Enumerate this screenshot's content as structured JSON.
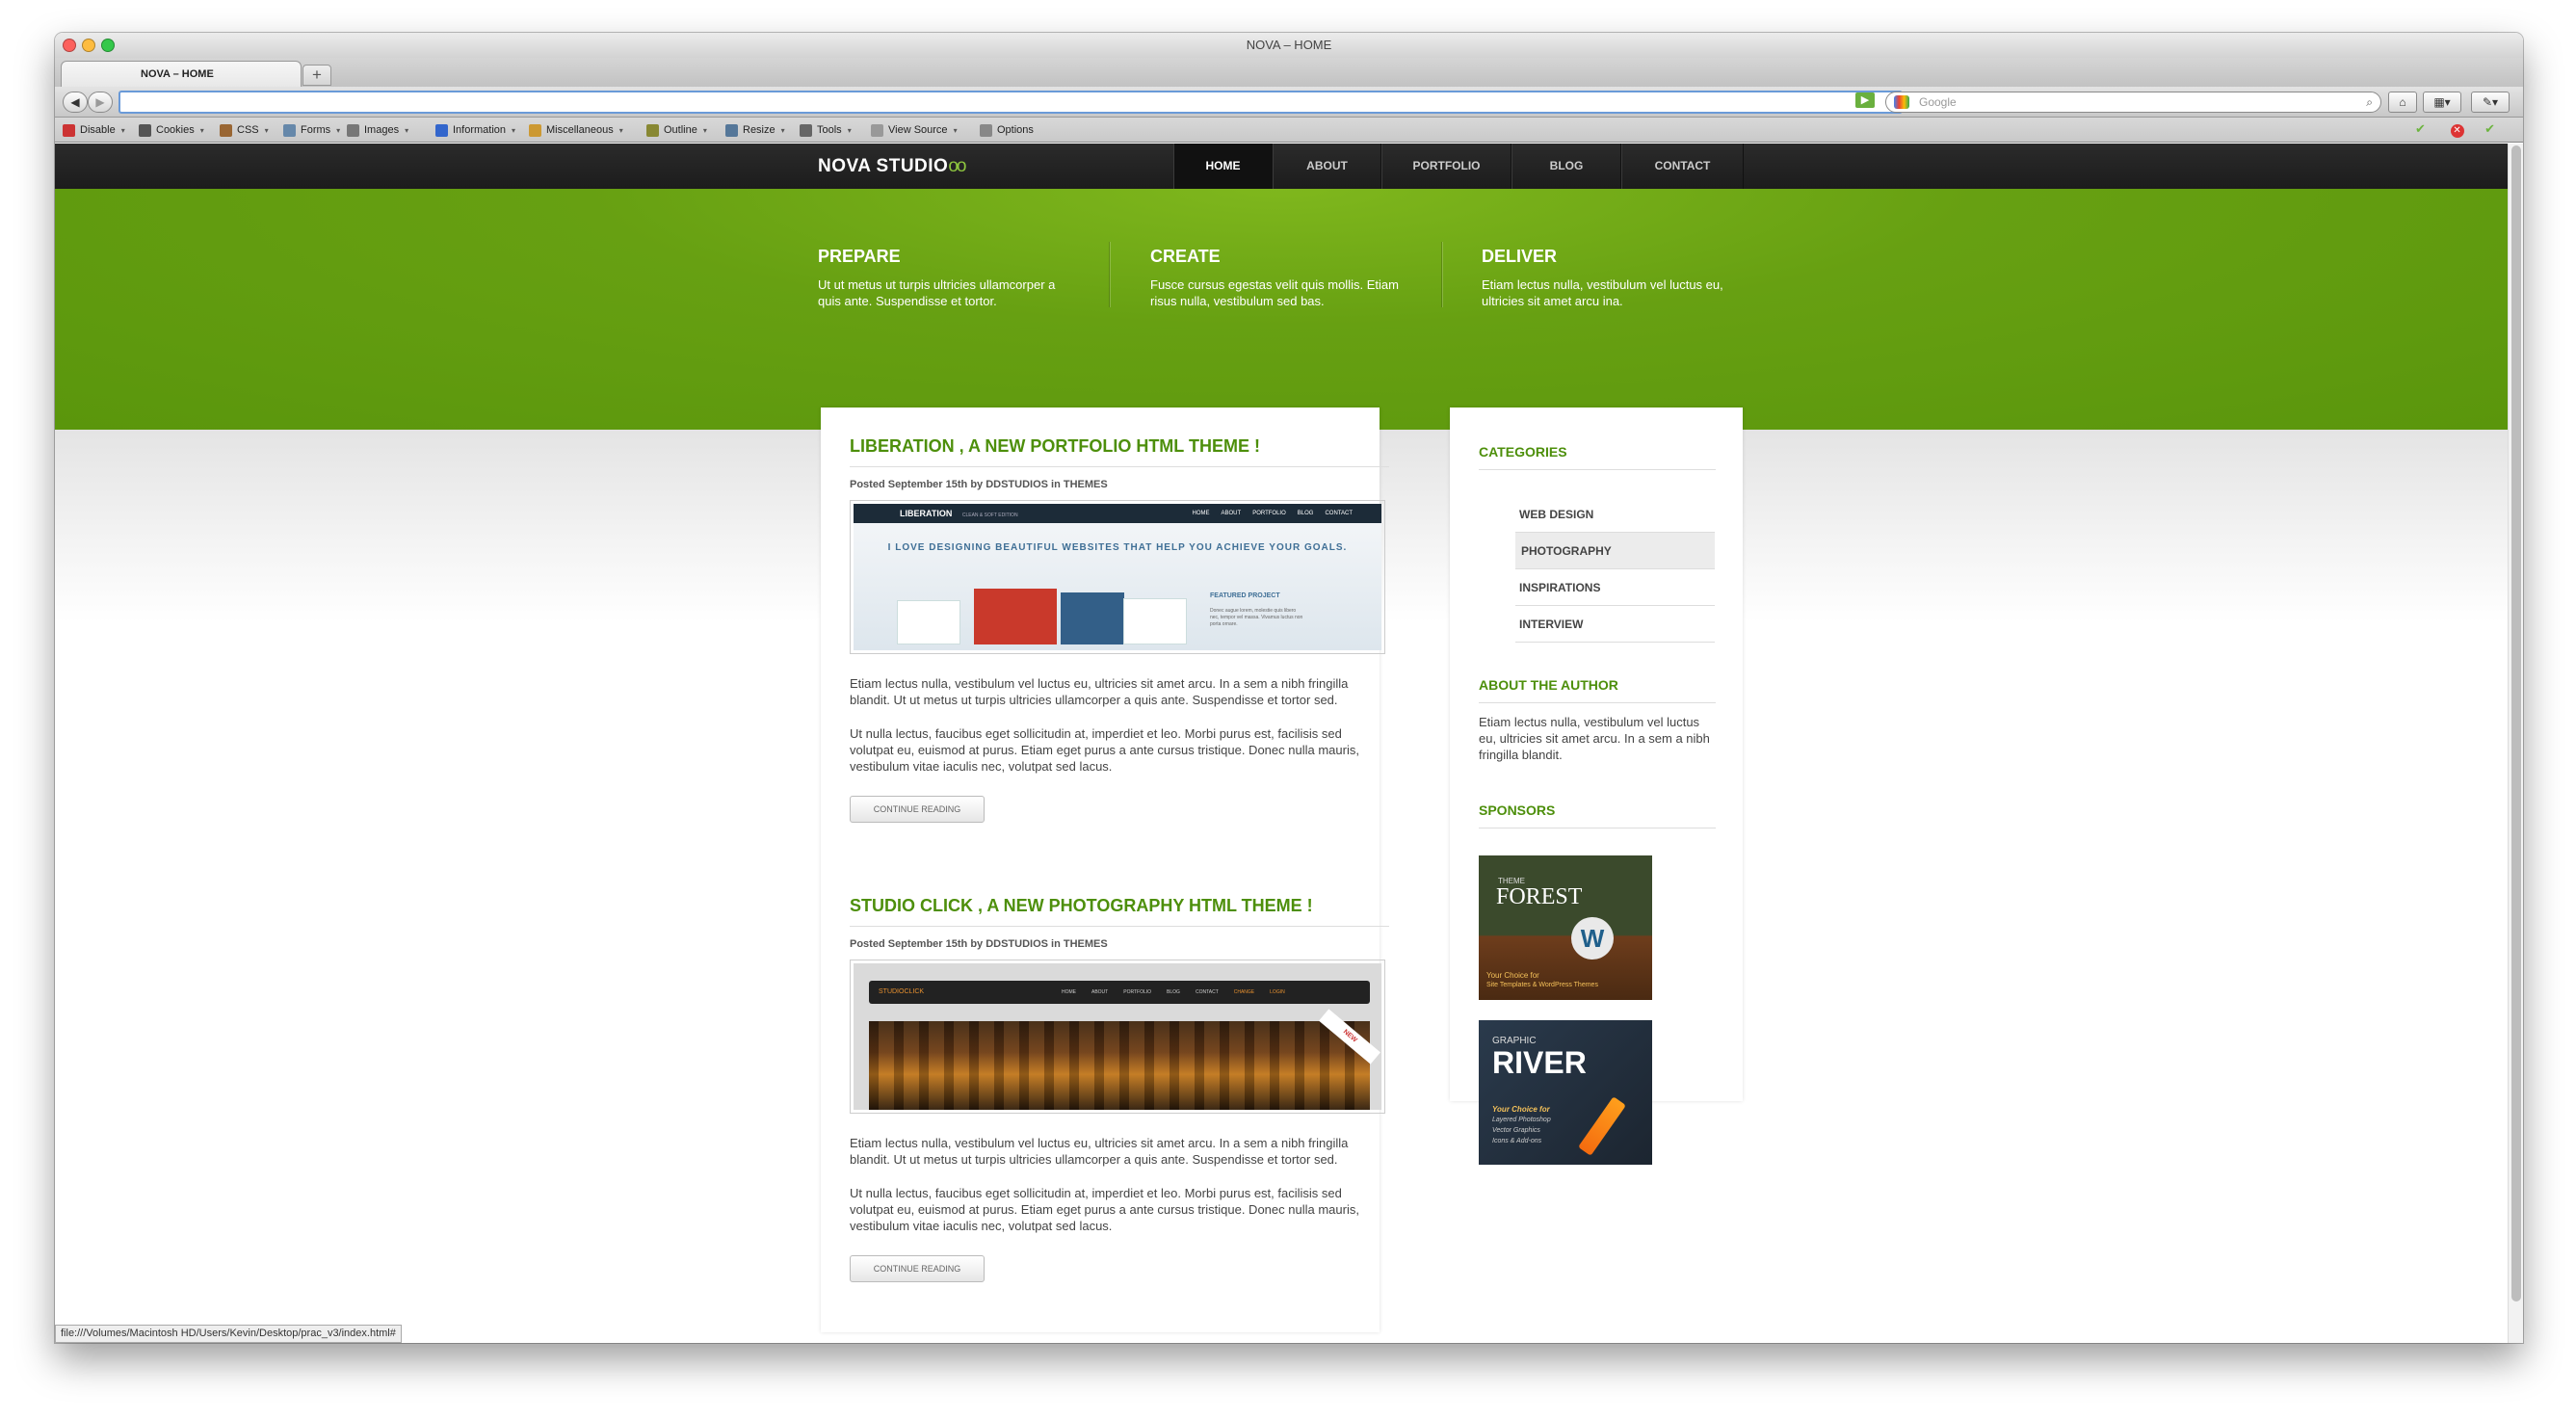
{
  "window": {
    "title": "NOVA – HOME",
    "tab_title": "NOVA – HOME",
    "new_tab": "+"
  },
  "browser": {
    "url": "",
    "search_placeholder": "Google",
    "back": "◀",
    "forward": "▶"
  },
  "devtoolbar": {
    "items": [
      {
        "label": "Disable",
        "icon": "disable-icon",
        "color": "#cc3333"
      },
      {
        "label": "Cookies",
        "icon": "cookies-icon",
        "color": "#555555"
      },
      {
        "label": "CSS",
        "icon": "css-icon",
        "color": "#996633"
      },
      {
        "label": "Forms",
        "icon": "forms-icon",
        "color": "#6688aa"
      },
      {
        "label": "Images",
        "icon": "images-icon",
        "color": "#777777"
      },
      {
        "label": "Information",
        "icon": "information-icon",
        "color": "#3366cc"
      },
      {
        "label": "Miscellaneous",
        "icon": "miscellaneous-icon",
        "color": "#cc9933"
      },
      {
        "label": "Outline",
        "icon": "outline-icon",
        "color": "#888833"
      },
      {
        "label": "Resize",
        "icon": "resize-icon",
        "color": "#557799"
      },
      {
        "label": "Tools",
        "icon": "tools-icon",
        "color": "#666666"
      },
      {
        "label": "View Source",
        "icon": "view-source-icon",
        "color": "#999999"
      },
      {
        "label": "Options",
        "icon": "options-icon",
        "color": "#888888"
      }
    ]
  },
  "site": {
    "logo": "NOVA STUDIO",
    "logo_mark": "oo",
    "nav": [
      "HOME",
      "ABOUT",
      "PORTFOLIO",
      "BLOG",
      "CONTACT"
    ],
    "nav_active": "HOME",
    "accent": "#5a960c",
    "features": [
      {
        "title": "PREPARE",
        "text": "Ut ut metus ut turpis ultricies ullamcorper a quis ante. Suspendisse et tortor."
      },
      {
        "title": "CREATE",
        "text": "Fusce cursus egestas velit quis mollis. Etiam risus nulla, vestibulum sed bas."
      },
      {
        "title": "DELIVER",
        "text": "Etiam lectus nulla, vestibulum vel luctus eu, ultricies sit amet arcu ina."
      }
    ],
    "posts": [
      {
        "title": "LIBERATION , A NEW PORTFOLIO HTML THEME !",
        "meta": "Posted September 15th by DDSTUDIOS in THEMES",
        "shot": {
          "brand": "LIBERATION",
          "brand_sub": "CLEAN & SOFT EDITION",
          "nav": [
            "HOME",
            "ABOUT",
            "PORTFOLIO",
            "BLOG",
            "CONTACT"
          ],
          "tagline": "I LOVE DESIGNING BEAUTIFUL WEBSITES THAT HELP YOU ACHIEVE YOUR GOALS.",
          "featured": "FEATURED PROJECT",
          "featured_text": "Donec augue lorem, molestie quis libero nec, tempor vel massa. Vivamus luctus non porta ornare."
        },
        "p1": "Etiam lectus nulla, vestibulum vel luctus eu, ultricies sit amet arcu. In a sem a nibh fringilla blandit. Ut ut metus ut turpis ultricies ullamcorper a quis ante. Suspendisse et tortor sed.",
        "p2": "Ut nulla lectus, faucibus eget sollicitudin at, imperdiet et leo. Morbi purus est, facilisis sed volutpat eu, euismod at purus. Etiam eget purus a ante cursus tristique. Donec nulla mauris, vestibulum vitae iaculis nec, volutpat sed lacus.",
        "button": "CONTINUE READING"
      },
      {
        "title": "STUDIO CLICK , A NEW PHOTOGRAPHY HTML THEME !",
        "meta": "Posted September 15th by DDSTUDIOS in THEMES",
        "shot": {
          "brand": "STUDIOCLICK",
          "nav": [
            "HOME",
            "ABOUT",
            "PORTFOLIO",
            "BLOG",
            "CONTACT",
            "CHANGE",
            "LOGIN"
          ],
          "ribbon": "NEW"
        },
        "p1": "Etiam lectus nulla, vestibulum vel luctus eu, ultricies sit amet arcu. In a sem a nibh fringilla blandit. Ut ut metus ut turpis ultricies ullamcorper a quis ante. Suspendisse et tortor sed.",
        "p2": "Ut nulla lectus, faucibus eget sollicitudin at, imperdiet et leo. Morbi purus est, facilisis sed volutpat eu, euismod at purus. Etiam eget purus a ante cursus tristique. Donec nulla mauris, vestibulum vitae iaculis nec, volutpat sed lacus.",
        "button": "CONTINUE READING"
      }
    ],
    "sidebar": {
      "categories_title": "CATEGORIES",
      "categories": [
        "WEB DESIGN",
        "PHOTOGRAPHY",
        "INSPIRATIONS",
        "INTERVIEW"
      ],
      "selected_category": "PHOTOGRAPHY",
      "author_title": "ABOUT THE AUTHOR",
      "author_text": "Etiam lectus nulla, vestibulum vel luctus eu, ultricies sit amet arcu. In a sem a nibh fringilla blandit.",
      "sponsors_title": "SPONSORS",
      "sponsors": [
        {
          "brand_small": "THEME",
          "brand": "FOREST",
          "line1": "Your Choice for",
          "line2": "Site Templates & WordPress Themes"
        },
        {
          "brand_small": "GRAPHIC",
          "brand": "RIVER",
          "line1": "Your Choice for",
          "line2": "Layered Photoshop",
          "line3": "Vector Graphics",
          "line4": "Icons & Add-ons"
        }
      ]
    }
  },
  "status": "file:///Volumes/Macintosh HD/Users/Kevin/Desktop/prac_v3/index.html#"
}
